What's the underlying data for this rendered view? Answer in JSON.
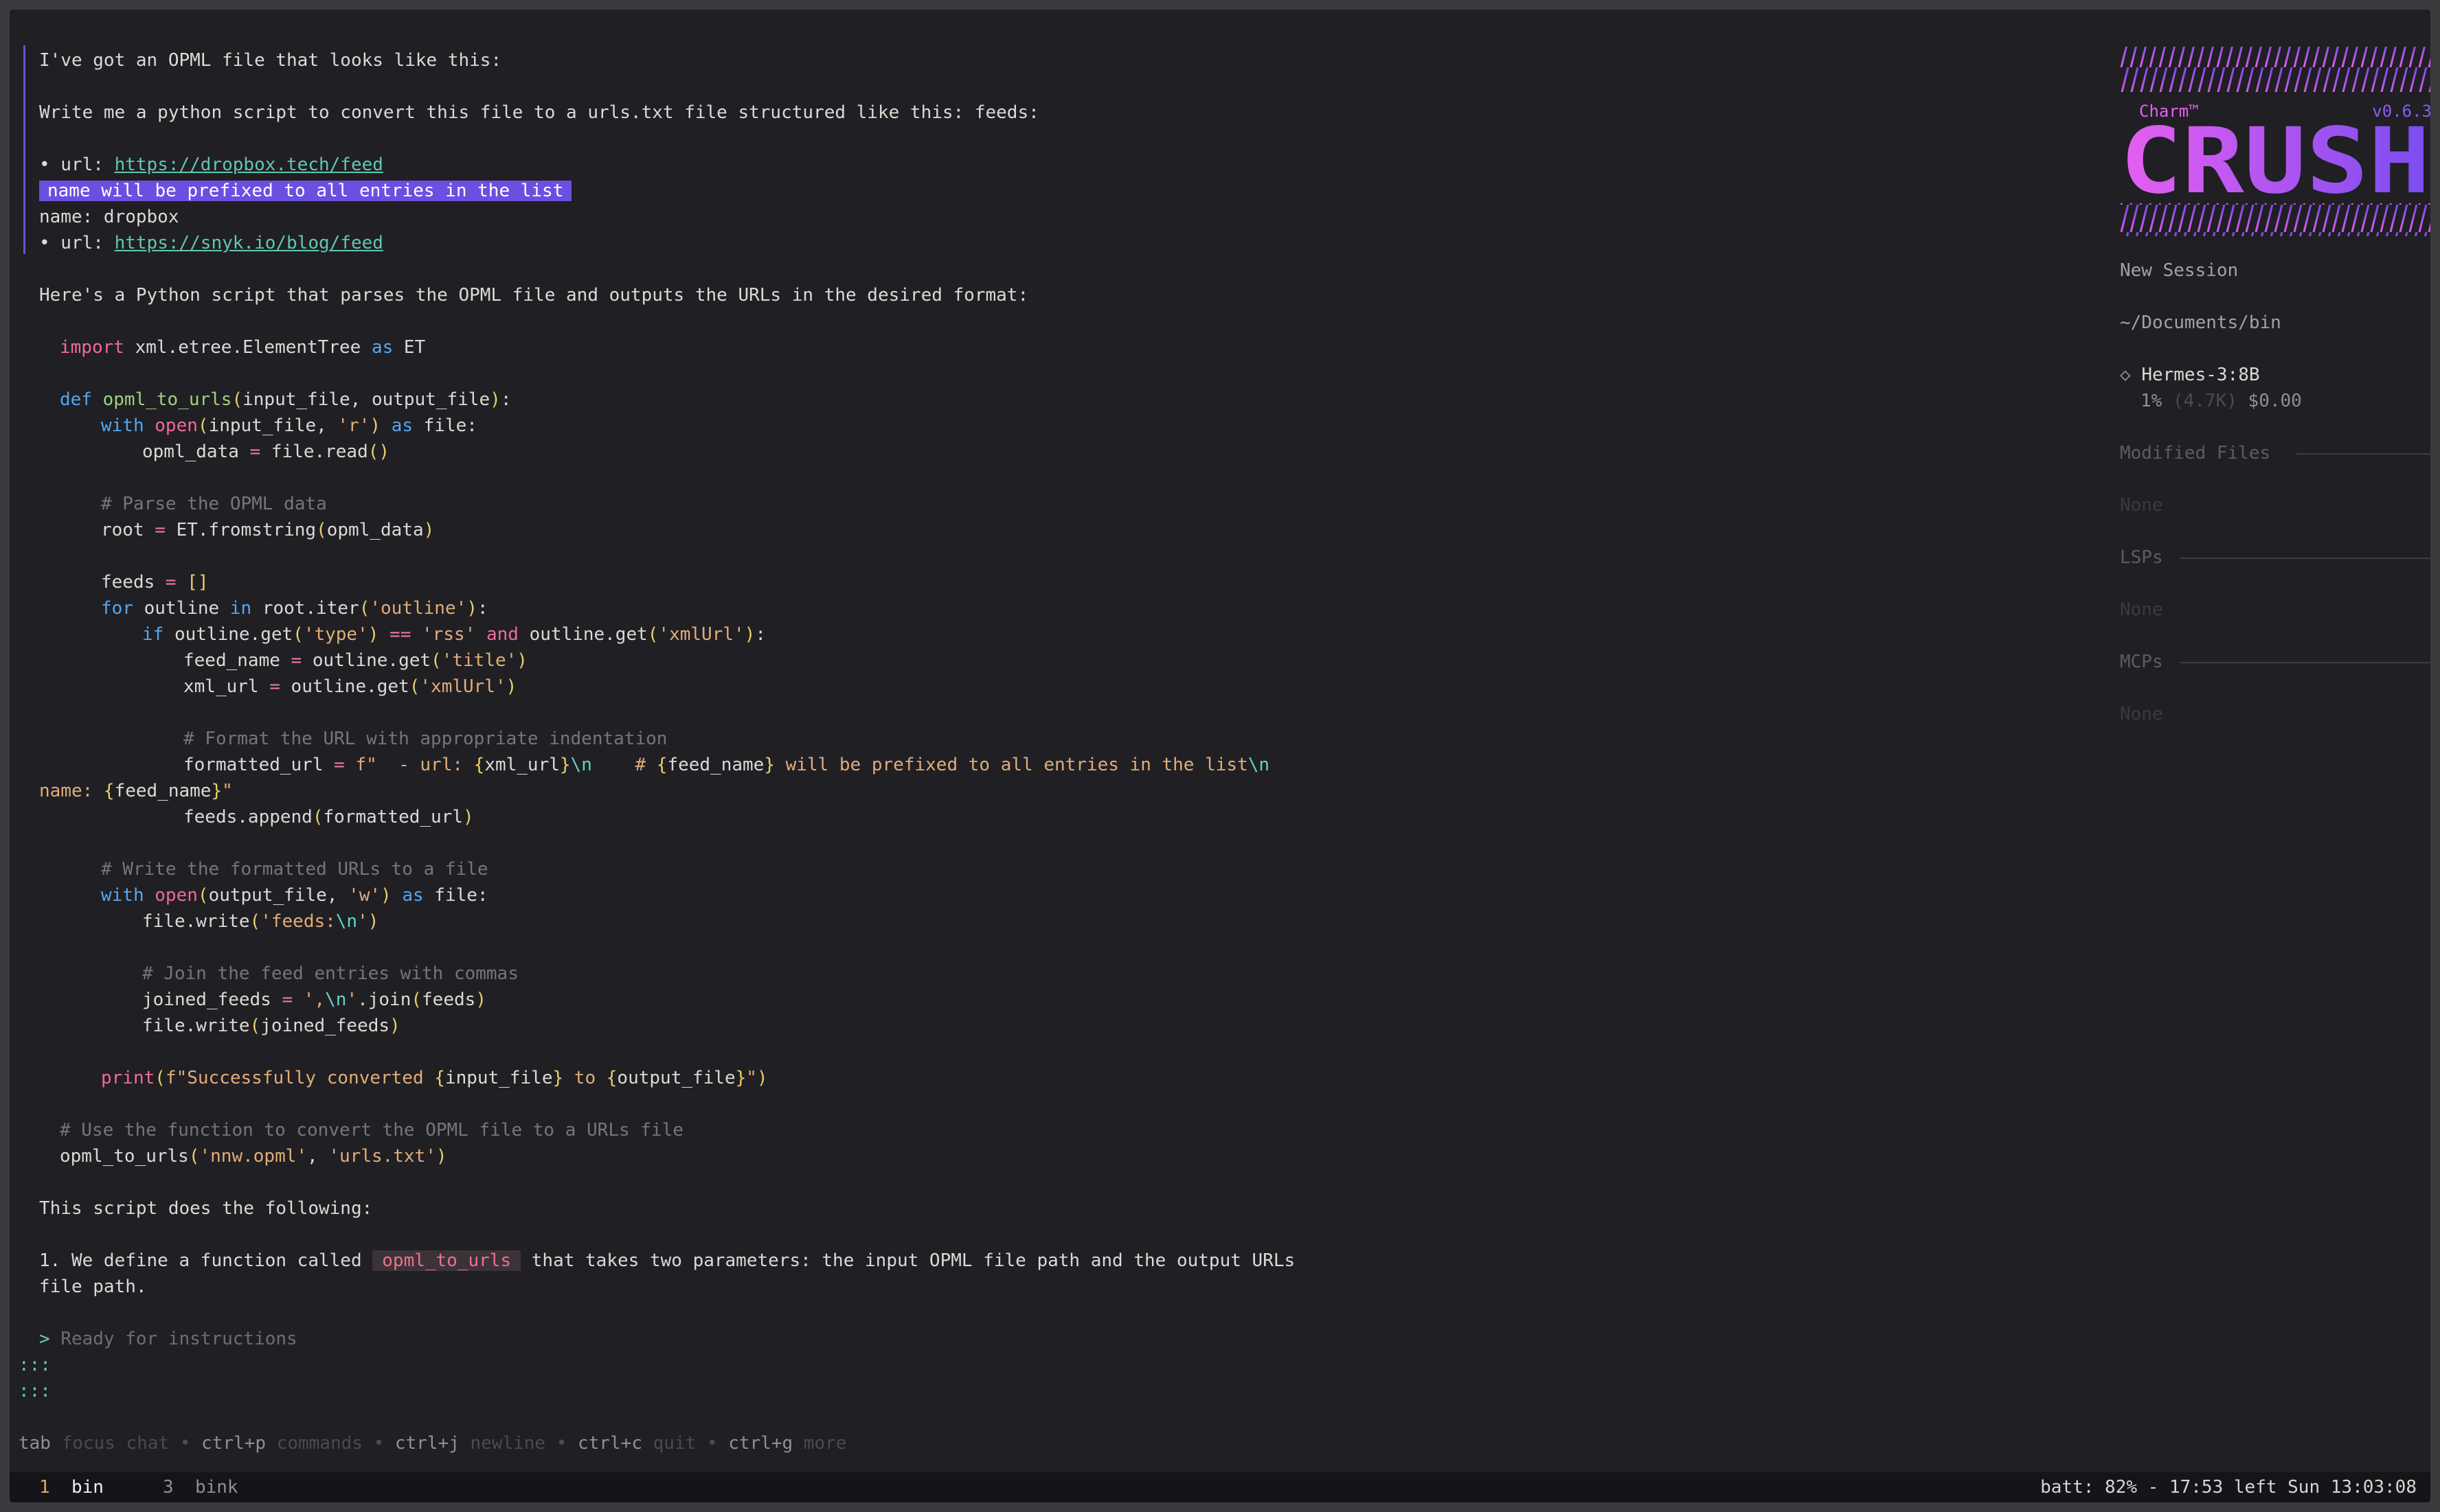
{
  "chat": {
    "user_message": {
      "line1": "I've got an OPML file that looks like this:",
      "line2": "Write me a python script to convert this file to a urls.txt file structured like this: feeds:",
      "bullet1_prefix": "• url: ",
      "bullet1_link": "https://dropbox.tech/feed",
      "highlight": "name will be prefixed to all entries in the list",
      "name_line": "name: dropbox",
      "bullet2_prefix": "• url: ",
      "bullet2_link": "https://snyk.io/blog/feed"
    },
    "reply_intro": "Here's a Python script that parses the OPML file and outputs the URLs in the desired format:",
    "code": {
      "l01_kw": "import",
      "l01_a": " xml.etree.ElementTree ",
      "l01_kw2": "as",
      "l01_b": " ET",
      "l02_kw": "def",
      "l02_fn": "opml_to_urls",
      "l02_args": "input_file, output_file",
      "l03_kw": "with",
      "l03_fn": "open",
      "l03_a": "input_file, ",
      "l03_str": "'r'",
      "l03_kw2": "as",
      "l03_b": " file:",
      "l04_a": "opml_data ",
      "l04_op": "=",
      "l04_b": " file.read",
      "l05_com": "# Parse the OPML data",
      "l06_a": "root ",
      "l06_op": "=",
      "l06_b": " ET.fromstring",
      "l06_arg": "opml_data",
      "l07_a": "feeds ",
      "l07_op": "=",
      "l07_b": "[]",
      "l08_kw": "for",
      "l08_a": " outline ",
      "l08_kw2": "in",
      "l08_b": " root.iter",
      "l08_str": "'outline'",
      "l08_c": ":",
      "l09_kw": "if",
      "l09_a": " outline.get",
      "l09_str1": "'type'",
      "l09_op": "==",
      "l09_str2": "'rss'",
      "l09_kw2": "and",
      "l09_b": " outline.get",
      "l09_str3": "'xmlUrl'",
      "l09_c": ":",
      "l10_a": "feed_name ",
      "l10_op": "=",
      "l10_b": " outline.get",
      "l10_str": "'title'",
      "l11_a": "xml_url ",
      "l11_op": "=",
      "l11_b": " outline.get",
      "l11_str": "'xmlUrl'",
      "l12_com": "# Format the URL with appropriate indentation",
      "l13_a": "formatted_url ",
      "l13_op": "=",
      "l13_str1": " f\"  - url: ",
      "l13_var1": "xml_url",
      "l13_esc1": "\\n",
      "l13_str2": "    # ",
      "l13_var2": "feed_name",
      "l13_str3": " will be prefixed to all entries in the list",
      "l13_esc2": "\\n",
      "l14_str1": "name: ",
      "l14_var": "feed_name",
      "l14_str2": "\"",
      "l15_a": "feeds.append",
      "l15_arg": "formatted_url",
      "l16_com": "# Write the formatted URLs to a file",
      "l17_kw": "with",
      "l17_fn": "open",
      "l17_a": "output_file, ",
      "l17_str": "'w'",
      "l17_kw2": "as",
      "l17_b": " file:",
      "l18_a": "file.write",
      "l18_str": "'feeds:",
      "l18_esc": "\\n",
      "l18_str2": "'",
      "l19_com": "# Join the feed entries with commas",
      "l20_a": "joined_feeds ",
      "l20_op": "=",
      "l20_str": " ',",
      "l20_esc": "\\n",
      "l20_str2": "'",
      "l20_b": ".join",
      "l20_arg": "feeds",
      "l21_a": "file.write",
      "l21_arg": "joined_feeds",
      "l22_fn": "print",
      "l22_str1": "f\"Successfully converted ",
      "l22_var1": "input_file",
      "l22_str2": " to ",
      "l22_var2": "output_file",
      "l22_str3": "\"",
      "l23_com": "# Use the function to convert the OPML file to a URLs file",
      "l24_a": "opml_to_urls",
      "l24_str1": "'nnw.opml'",
      "l24_str2": "'urls.txt'"
    },
    "explain_intro": "This script does the following:",
    "explain_item_prefix": "1. We define a function called ",
    "explain_item_code": "opml_to_urls",
    "explain_item_suffix": " that takes two parameters: the input OPML file path and the output URLs",
    "explain_item_cont": "file path.",
    "prompt_arrow": ">",
    "prompt_placeholder": "Ready for instructions",
    "continuation_1": ":::",
    "continuation_2": ":::"
  },
  "help_bar": [
    {
      "key": "tab",
      "desc": "focus chat"
    },
    {
      "key": "ctrl+p",
      "desc": "commands"
    },
    {
      "key": "ctrl+j",
      "desc": "newline"
    },
    {
      "key": "ctrl+c",
      "desc": "quit"
    },
    {
      "key": "ctrl+g",
      "desc": "more"
    }
  ],
  "help_separator": "•",
  "sidebar": {
    "brand": "Charm™",
    "version": "v0.6.3",
    "logo_text": "CRUSH",
    "session_title": "New Session",
    "cwd": "~/Documents/bin",
    "model_icon": "◇",
    "model_name": "Hermes-3:8B",
    "usage_pct": "1%",
    "usage_tokens": "(4.7K)",
    "usage_cost": "$0.00",
    "modified_files_header": "Modified Files",
    "modified_files_value": "None",
    "lsps_header": "LSPs",
    "lsps_value": "None",
    "mcps_header": "MCPs",
    "mcps_value": "None",
    "colors": {
      "logo_start": "#e75ff2",
      "logo_end": "#7a4cf0",
      "brand": "#e75ff2",
      "version": "#8b5cf6"
    }
  },
  "status_bar": {
    "win1_index": "1",
    "win1_name": "bin",
    "win2_index": "3",
    "win2_name": "bink",
    "right": "batt: 82% - 17:53 left Sun 13:03:08"
  }
}
